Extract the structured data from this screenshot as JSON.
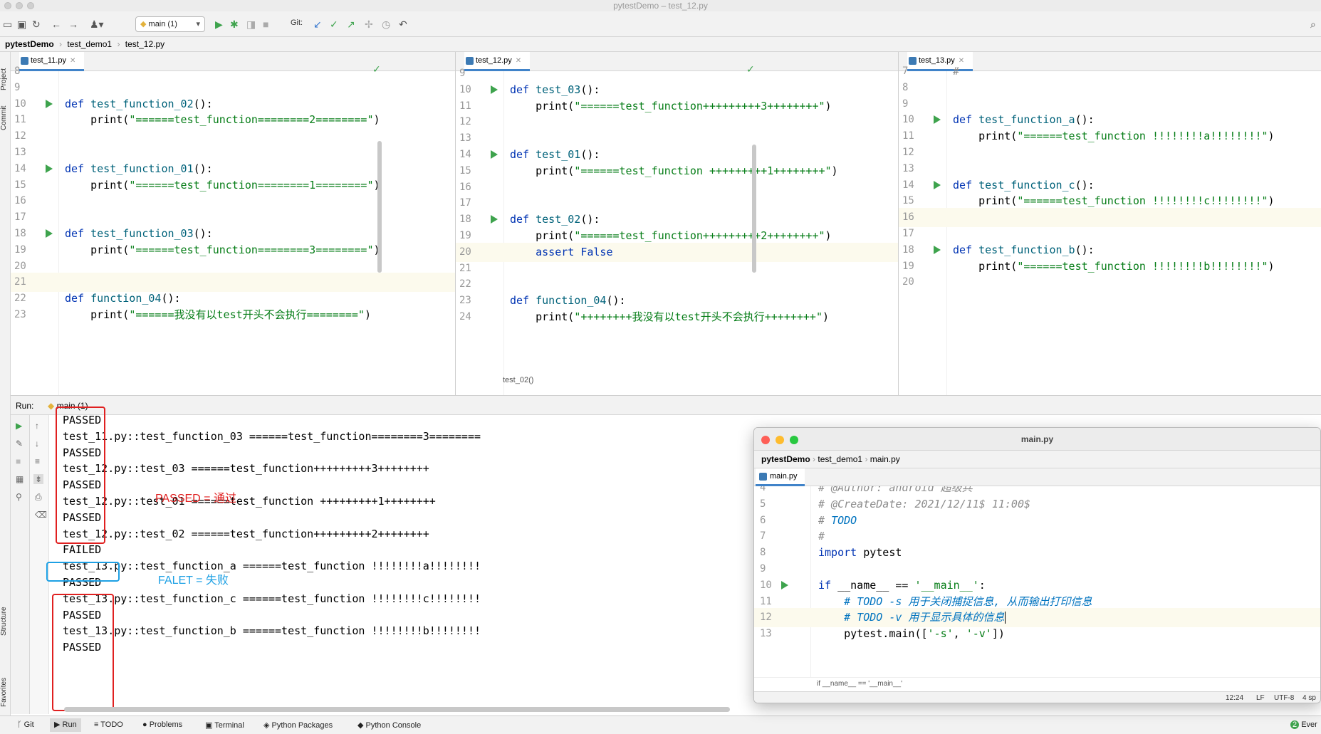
{
  "window": {
    "title": "pytestDemo – test_12.py"
  },
  "toolbar": {
    "run_config": "main (1)",
    "git_label": "Git:"
  },
  "breadcrumb": [
    "pytestDemo",
    "test_demo1",
    "test_12.py"
  ],
  "left_strip": {
    "project": "Project",
    "commit": "Commit",
    "structure": "Structure",
    "favorites": "Favorites"
  },
  "editors": [
    {
      "tab": "test_11.py",
      "lines": [
        {
          "n": "8",
          "parts": []
        },
        {
          "n": "9",
          "parts": []
        },
        {
          "n": "10",
          "run": true,
          "parts": [
            [
              "kw",
              "def "
            ],
            [
              "fn",
              "test_function_02"
            ],
            [
              "",
              "():"
            ]
          ]
        },
        {
          "n": "11",
          "parts": [
            [
              "",
              "    print("
            ],
            [
              "st",
              "\"======test_function========2========\""
            ],
            [
              "",
              ")"
            ]
          ]
        },
        {
          "n": "12",
          "parts": []
        },
        {
          "n": "13",
          "parts": []
        },
        {
          "n": "14",
          "run": true,
          "parts": [
            [
              "kw",
              "def "
            ],
            [
              "fn",
              "test_function_01"
            ],
            [
              "",
              "():"
            ]
          ]
        },
        {
          "n": "15",
          "parts": [
            [
              "",
              "    print("
            ],
            [
              "st",
              "\"======test_function========1========\""
            ],
            [
              "",
              ")"
            ]
          ]
        },
        {
          "n": "16",
          "parts": []
        },
        {
          "n": "17",
          "parts": []
        },
        {
          "n": "18",
          "run": true,
          "parts": [
            [
              "kw",
              "def "
            ],
            [
              "fn",
              "test_function_03"
            ],
            [
              "",
              "():"
            ]
          ]
        },
        {
          "n": "19",
          "parts": [
            [
              "",
              "    print("
            ],
            [
              "st",
              "\"======test_function========3========\""
            ],
            [
              "",
              ")"
            ]
          ]
        },
        {
          "n": "20",
          "parts": []
        },
        {
          "n": "21",
          "hl": true,
          "parts": []
        },
        {
          "n": "22",
          "parts": [
            [
              "kw",
              "def "
            ],
            [
              "fn",
              "function_04"
            ],
            [
              "",
              "():"
            ]
          ]
        },
        {
          "n": "23",
          "parts": [
            [
              "",
              "    print("
            ],
            [
              "st",
              "\"======我没有以test开头不会执行========\""
            ],
            [
              "",
              ")"
            ]
          ]
        }
      ]
    },
    {
      "tab": "test_12.py",
      "hint": "test_02()",
      "lines": [
        {
          "n": "9",
          "parts": []
        },
        {
          "n": "10",
          "run": true,
          "parts": [
            [
              "kw",
              "def "
            ],
            [
              "fn",
              "test_03"
            ],
            [
              "",
              "():"
            ]
          ]
        },
        {
          "n": "11",
          "parts": [
            [
              "",
              "    print("
            ],
            [
              "st",
              "\"======test_function+++++++++3++++++++\""
            ],
            [
              "",
              ")"
            ]
          ]
        },
        {
          "n": "12",
          "parts": []
        },
        {
          "n": "13",
          "parts": []
        },
        {
          "n": "14",
          "run": true,
          "parts": [
            [
              "kw",
              "def "
            ],
            [
              "fn",
              "test_01"
            ],
            [
              "",
              "():"
            ]
          ]
        },
        {
          "n": "15",
          "parts": [
            [
              "",
              "    print("
            ],
            [
              "st",
              "\"======test_function +++++++++1++++++++\""
            ],
            [
              "",
              ")"
            ]
          ]
        },
        {
          "n": "16",
          "parts": []
        },
        {
          "n": "17",
          "parts": []
        },
        {
          "n": "18",
          "run": true,
          "parts": [
            [
              "kw",
              "def "
            ],
            [
              "fn",
              "test_02"
            ],
            [
              "",
              "():"
            ]
          ]
        },
        {
          "n": "19",
          "parts": [
            [
              "",
              "    print("
            ],
            [
              "st",
              "\"======test_function+++++++++2++++++++\""
            ],
            [
              "",
              ")"
            ]
          ]
        },
        {
          "n": "20",
          "hl": true,
          "parts": [
            [
              "",
              "    "
            ],
            [
              "kw",
              "assert False"
            ]
          ]
        },
        {
          "n": "21",
          "parts": []
        },
        {
          "n": "22",
          "parts": []
        },
        {
          "n": "23",
          "parts": [
            [
              "kw",
              "def "
            ],
            [
              "fn",
              "function_04"
            ],
            [
              "",
              "():"
            ]
          ]
        },
        {
          "n": "24",
          "parts": [
            [
              "",
              "    print("
            ],
            [
              "st",
              "\"++++++++我没有以test开头不会执行++++++++\""
            ],
            [
              "",
              ")"
            ]
          ]
        }
      ]
    },
    {
      "tab": "test_13.py",
      "lines": [
        {
          "n": "7",
          "parts": [
            [
              "cm",
              "#"
            ]
          ]
        },
        {
          "n": "8",
          "parts": []
        },
        {
          "n": "9",
          "parts": []
        },
        {
          "n": "10",
          "run": true,
          "parts": [
            [
              "kw",
              "def "
            ],
            [
              "fn",
              "test_function_a"
            ],
            [
              "",
              "():"
            ]
          ]
        },
        {
          "n": "11",
          "parts": [
            [
              "",
              "    print("
            ],
            [
              "st",
              "\"======test_function !!!!!!!!a!!!!!!!!\""
            ],
            [
              "",
              ")"
            ]
          ]
        },
        {
          "n": "12",
          "parts": []
        },
        {
          "n": "13",
          "parts": []
        },
        {
          "n": "14",
          "run": true,
          "parts": [
            [
              "kw",
              "def "
            ],
            [
              "fn",
              "test_function_c"
            ],
            [
              "",
              "():"
            ]
          ]
        },
        {
          "n": "15",
          "parts": [
            [
              "",
              "    print("
            ],
            [
              "st",
              "\"======test_function !!!!!!!!c!!!!!!!!\""
            ],
            [
              "",
              ")"
            ]
          ]
        },
        {
          "n": "16",
          "hl": true,
          "parts": []
        },
        {
          "n": "17",
          "parts": []
        },
        {
          "n": "18",
          "run": true,
          "parts": [
            [
              "kw",
              "def "
            ],
            [
              "fn",
              "test_function_b"
            ],
            [
              "",
              "():"
            ]
          ]
        },
        {
          "n": "19",
          "parts": [
            [
              "",
              "    print("
            ],
            [
              "st",
              "\"======test_function !!!!!!!!b!!!!!!!!\""
            ],
            [
              "",
              ")"
            ]
          ]
        },
        {
          "n": "20",
          "parts": []
        }
      ]
    }
  ],
  "run": {
    "label": "Run:",
    "tab": "main (1)",
    "output": [
      "PASSED",
      "test_11.py::test_function_03 ======test_function========3========",
      "PASSED",
      "test_12.py::test_03 ======test_function+++++++++3++++++++",
      "PASSED",
      "test_12.py::test_01 ======test_function +++++++++1++++++++",
      "PASSED",
      "test_12.py::test_02 ======test_function+++++++++2++++++++",
      "FAILED",
      "test_13.py::test_function_a ======test_function !!!!!!!!a!!!!!!!!",
      "PASSED",
      "test_13.py::test_function_c ======test_function !!!!!!!!c!!!!!!!!",
      "PASSED",
      "test_13.py::test_function_b ======test_function !!!!!!!!b!!!!!!!!",
      "PASSED"
    ],
    "annotations": {
      "passed": "PASSED = 通过",
      "failed": "FALET = 失败"
    }
  },
  "bottom_bar": [
    "Git",
    "Run",
    "TODO",
    "Problems",
    "Terminal",
    "Python Packages",
    "Python Console"
  ],
  "bottom_right": "Ever",
  "float_window": {
    "title": "main.py",
    "breadcrumb": [
      "pytestDemo",
      "test_demo1",
      "main.py"
    ],
    "tab": "main.py",
    "lines": [
      {
        "n": "4",
        "parts": [
          [
            "cm",
            "# @Author: android 超级兵"
          ]
        ]
      },
      {
        "n": "5",
        "parts": [
          [
            "cm",
            "# @CreateDate: 2021/12/11$ 11:00$"
          ]
        ]
      },
      {
        "n": "6",
        "parts": [
          [
            "cm",
            "# "
          ],
          [
            "todo",
            "TODO"
          ]
        ]
      },
      {
        "n": "7",
        "parts": [
          [
            "cm",
            "#"
          ]
        ]
      },
      {
        "n": "8",
        "parts": [
          [
            "kw",
            "import "
          ],
          [
            "",
            "pytest"
          ]
        ]
      },
      {
        "n": "9",
        "parts": []
      },
      {
        "n": "10",
        "run": true,
        "parts": [
          [
            "kw",
            "if "
          ],
          [
            "",
            "__name__ == "
          ],
          [
            "st",
            "'__main__'"
          ],
          [
            "",
            ":"
          ]
        ]
      },
      {
        "n": "11",
        "parts": [
          [
            "",
            "    "
          ],
          [
            "todo",
            "# TODO -s 用于关闭捕捉信息, 从而输出打印信息"
          ]
        ]
      },
      {
        "n": "12",
        "hl": true,
        "caret": true,
        "parts": [
          [
            "",
            "    "
          ],
          [
            "todo",
            "# TODO -v 用于显示具体的信息"
          ]
        ]
      },
      {
        "n": "13",
        "parts": [
          [
            "",
            "    pytest.main(["
          ],
          [
            "st",
            "'-s'"
          ],
          [
            "",
            ", "
          ],
          [
            "st",
            "'-v'"
          ],
          [
            "",
            "])"
          ]
        ]
      }
    ],
    "status_hint": "if __name__ == '__main__'",
    "status_right": {
      "position": "12:24",
      "line_sep": "LF",
      "encoding": "UTF-8",
      "indent": "4 sp"
    }
  }
}
